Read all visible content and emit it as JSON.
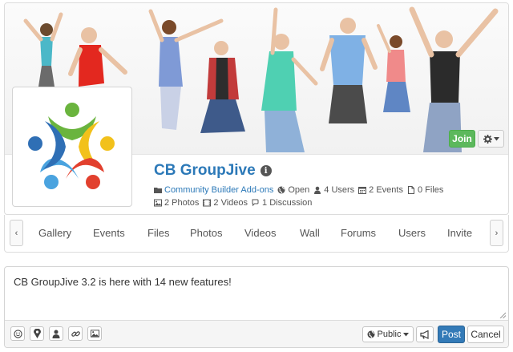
{
  "group": {
    "name": "CB GroupJive",
    "category": "Community Builder Add-ons",
    "access": "Open",
    "users": "4 Users",
    "events": "2 Events",
    "files": "0 Files",
    "photos": "2 Photos",
    "videos": "2 Videos",
    "discussions": "1 Discussion"
  },
  "actions": {
    "join_label": "Join"
  },
  "nav": {
    "prev_label": "‹",
    "next_label": "›",
    "tabs": [
      "Gallery",
      "Events",
      "Files",
      "Photos",
      "Videos",
      "Wall",
      "Forums",
      "Users",
      "Invite"
    ]
  },
  "composer": {
    "text": "CB GroupJive 3.2 is here with 14 new features!",
    "privacy_label": "Public",
    "post_label": "Post",
    "cancel_label": "Cancel"
  },
  "colors": {
    "link": "#2c79b8",
    "join": "#5cb85c",
    "post": "#337ab7",
    "logo_blue": "#2f6fb5",
    "logo_green": "#6ab43e",
    "logo_yellow": "#f2c11b",
    "logo_red": "#e2402e",
    "logo_lightblue": "#4aa3df"
  }
}
